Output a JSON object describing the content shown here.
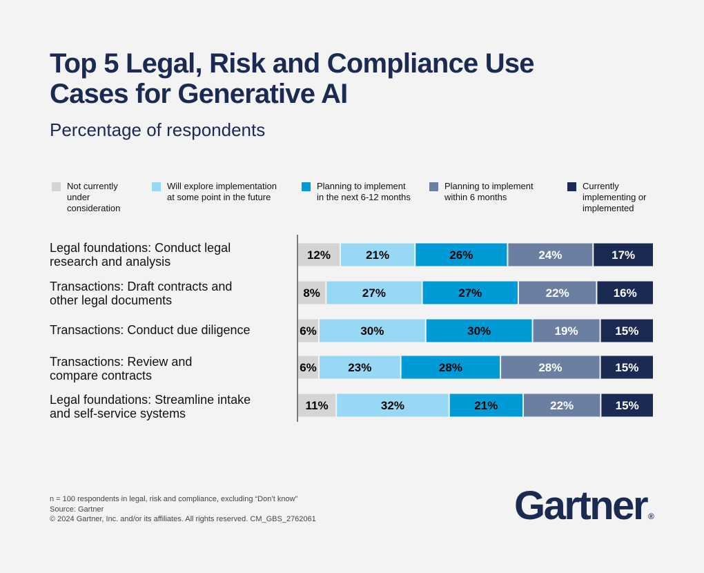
{
  "header": {
    "title": "Top 5 Legal, Risk and Compliance Use Cases for Generative AI",
    "subtitle": "Percentage of respondents"
  },
  "legend": [
    {
      "label": "Not currently\nunder\nconsideration",
      "color": "#d4d4d4"
    },
    {
      "label": "Will explore implementation\nat some point in the future",
      "color": "#97d9f5"
    },
    {
      "label": "Planning to implement\nin the next 6-12 months",
      "color": "#009bd6"
    },
    {
      "label": "Planning to implement\nwithin 6 months",
      "color": "#6b7fa3"
    },
    {
      "label": "Currently\nimplementing or\nimplemented",
      "color": "#1a2a52"
    }
  ],
  "chart_data": {
    "type": "bar",
    "orientation": "horizontal",
    "stacked": true,
    "title": "Top 5 Legal, Risk and Compliance Use Cases for Generative AI",
    "subtitle": "Percentage of respondents",
    "xlabel": "",
    "ylabel": "",
    "xlim": [
      0,
      100
    ],
    "unit": "%",
    "grid": false,
    "legend_position": "top",
    "categories": [
      "Legal foundations: Conduct legal\nresearch and analysis",
      "Transactions: Draft contracts and\nother legal documents",
      "Transactions: Conduct due diligence",
      "Transactions: Review and\ncompare contracts",
      "Legal foundations: Streamline intake\nand self-service systems"
    ],
    "series": [
      {
        "name": "Not currently under consideration",
        "color": "#d4d4d4",
        "label_color": "#000000",
        "values": [
          12,
          8,
          6,
          6,
          11
        ]
      },
      {
        "name": "Will explore implementation at some point in the future",
        "color": "#97d9f5",
        "label_color": "#000000",
        "values": [
          21,
          27,
          30,
          23,
          32
        ]
      },
      {
        "name": "Planning to implement in the next 6-12 months",
        "color": "#009bd6",
        "label_color": "#000000",
        "values": [
          26,
          27,
          30,
          28,
          21
        ]
      },
      {
        "name": "Planning to implement within 6 months",
        "color": "#6b7fa3",
        "label_color": "#ffffff",
        "values": [
          24,
          22,
          19,
          28,
          22
        ]
      },
      {
        "name": "Currently implementing or implemented",
        "color": "#1a2a52",
        "label_color": "#ffffff",
        "values": [
          17,
          16,
          15,
          15,
          15
        ]
      }
    ]
  },
  "footer": {
    "note": "n = 100 respondents in legal, risk and compliance, excluding “Don’t know”",
    "source": "Source: Gartner",
    "copyright": "© 2024 Gartner, Inc. and/or its affiliates. All rights reserved. CM_GBS_2762061"
  },
  "logo": {
    "text": "Gartner",
    "mark": "®"
  }
}
